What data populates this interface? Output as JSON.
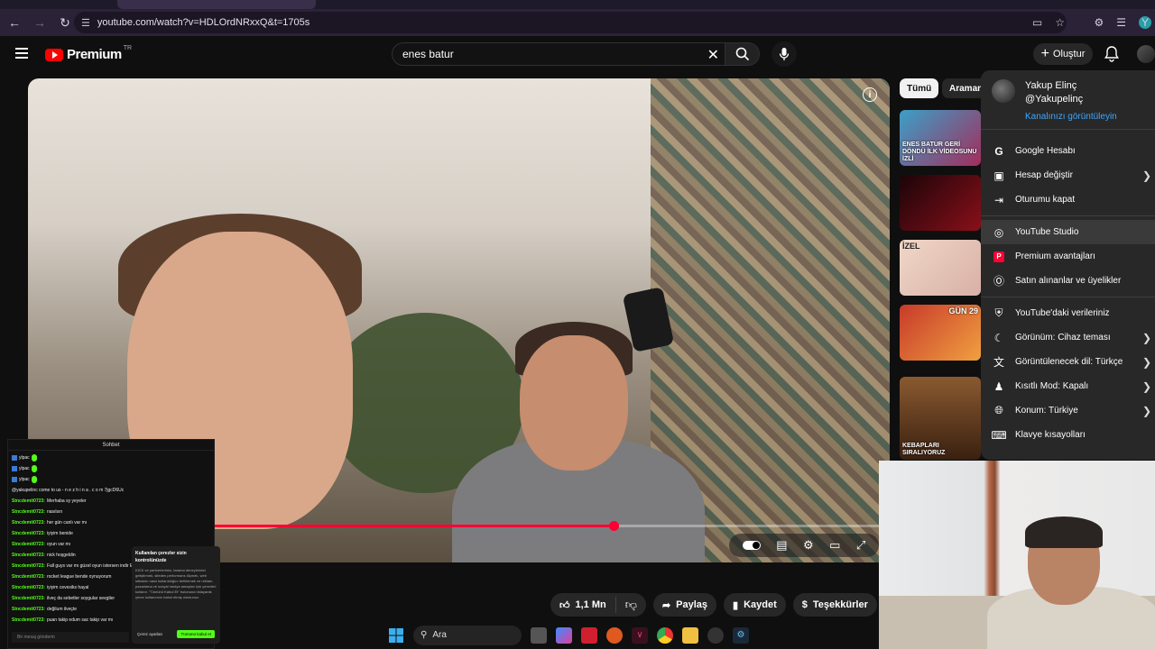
{
  "browser": {
    "url": "youtube.com/watch?v=HDLOrdNRxxQ&t=1705s",
    "profile_initial": "Y"
  },
  "masthead": {
    "logo_text": "Premium",
    "country_code": "TR",
    "search_query": "enes batur",
    "create_label": "Oluştur"
  },
  "video": {
    "progress_fraction": 0.6
  },
  "actions": {
    "like_count": "1,1 Mn",
    "share_label": "Paylaş",
    "save_label": "Kaydet",
    "thanks_label": "Teşekkürler"
  },
  "side": {
    "chips": [
      "Tümü",
      "Araman"
    ],
    "thumbs": [
      {
        "caption": "ENES BATUR GERİ DÖNDÜ İLK VİDEOSUNU İZLİ"
      },
      {
        "caption": ""
      },
      {
        "caption": "İZEL"
      },
      {
        "caption": "GÜN 29"
      },
      {
        "caption": "KEBAPLARI SIRALIYORUZ"
      }
    ]
  },
  "account_menu": {
    "name": "Yakup Elinç",
    "handle": "@Yakupelinç",
    "channel_link": "Kanalınızı görüntüleyin",
    "group1": [
      {
        "label": "Google Hesabı",
        "icon": "google-icon",
        "chevron": false
      },
      {
        "label": "Hesap değiştir",
        "icon": "switch-account-icon",
        "chevron": true
      },
      {
        "label": "Oturumu kapat",
        "icon": "sign-out-icon",
        "chevron": false
      }
    ],
    "group2": [
      {
        "label": "YouTube Studio",
        "icon": "studio-icon",
        "chevron": false
      },
      {
        "label": "Premium avantajları",
        "icon": "premium-icon",
        "chevron": false
      },
      {
        "label": "Satın alınanlar ve üyelikler",
        "icon": "dollar-icon",
        "chevron": false
      }
    ],
    "group3": [
      {
        "label": "YouTube'daki verileriniz",
        "icon": "shield-icon",
        "chevron": false
      },
      {
        "label": "Görünüm: Cihaz teması",
        "icon": "moon-icon",
        "chevron": true
      },
      {
        "label": "Görüntülenecek dil: Türkçe",
        "icon": "translate-icon",
        "chevron": true
      },
      {
        "label": "Kısıtlı Mod: Kapalı",
        "icon": "person-lock-icon",
        "chevron": true
      },
      {
        "label": "Konum: Türkiye",
        "icon": "globe-icon",
        "chevron": true
      },
      {
        "label": "Klavye kısayolları",
        "icon": "keyboard-icon",
        "chevron": false
      }
    ]
  },
  "chat": {
    "title": "Sohbet",
    "lines": [
      {
        "user": "",
        "text": "ylpac",
        "type": "badge"
      },
      {
        "user": "",
        "text": "ylpac",
        "type": "badge"
      },
      {
        "user": "",
        "text": "ylpac",
        "type": "badge"
      },
      {
        "user": "",
        "text": "@yakupelinc come to us - n e z h i n a . c o m 7jgcD6Uc",
        "type": "plain"
      },
      {
        "user": "Stncdemit0723:",
        "text": "Merhaba sy yeyeler",
        "type": "user"
      },
      {
        "user": "Stncdemit0723:",
        "text": "nasılsın",
        "type": "user"
      },
      {
        "user": "Stncdemit0723:",
        "text": "her gün canlı var mı",
        "type": "user"
      },
      {
        "user": "Stncdemit0723:",
        "text": "iyiyim benide",
        "type": "user"
      },
      {
        "user": "Stncdemit0723:",
        "text": "oyun var mı",
        "type": "user"
      },
      {
        "user": "Stncdemit0723:",
        "text": "nick hoşgeldin",
        "type": "user"
      },
      {
        "user": "Stncdemit0723:",
        "text": "Fall guys var mı güzel oyun istersen indir Epic games",
        "type": "user"
      },
      {
        "user": "Stncdemit0723:",
        "text": "rocket league bende oynuyorum",
        "type": "user"
      },
      {
        "user": "Stncdemit0723:",
        "text": "iyiyim cevesiks hayal",
        "type": "user"
      },
      {
        "user": "Stncdemit0723:",
        "text": "ilveç da sebetler soygular sevgiler",
        "type": "user"
      },
      {
        "user": "Stncdemit0723:",
        "text": "değilum ilveçte",
        "type": "user"
      },
      {
        "user": "Stncdemit0723:",
        "text": "puan takip edum sac takip var mı",
        "type": "user"
      }
    ],
    "input_placeholder": "Bir mesaj gönderin",
    "popup_title": "Kullanılan çerezler sizin kontrolünüzde",
    "popup_body": "KICK ve partnerlerimiz, tarama deneyiminizi geliştirmek, siteden performans ölçmek, web sitesinin nasıl kullanıldığını belirlemek ve reklam, pazarlama ve sosyal medya amaçları için çerezleri kullanır. \"Tümünü Kabul Et\" butonuna tıklayarak çerez kullanımını kabul etmiş olursunuz.",
    "popup_secondary": "Çerez ayarları",
    "popup_primary": "Tümünü kabul et"
  },
  "taskbar": {
    "search_label": "Ara"
  }
}
